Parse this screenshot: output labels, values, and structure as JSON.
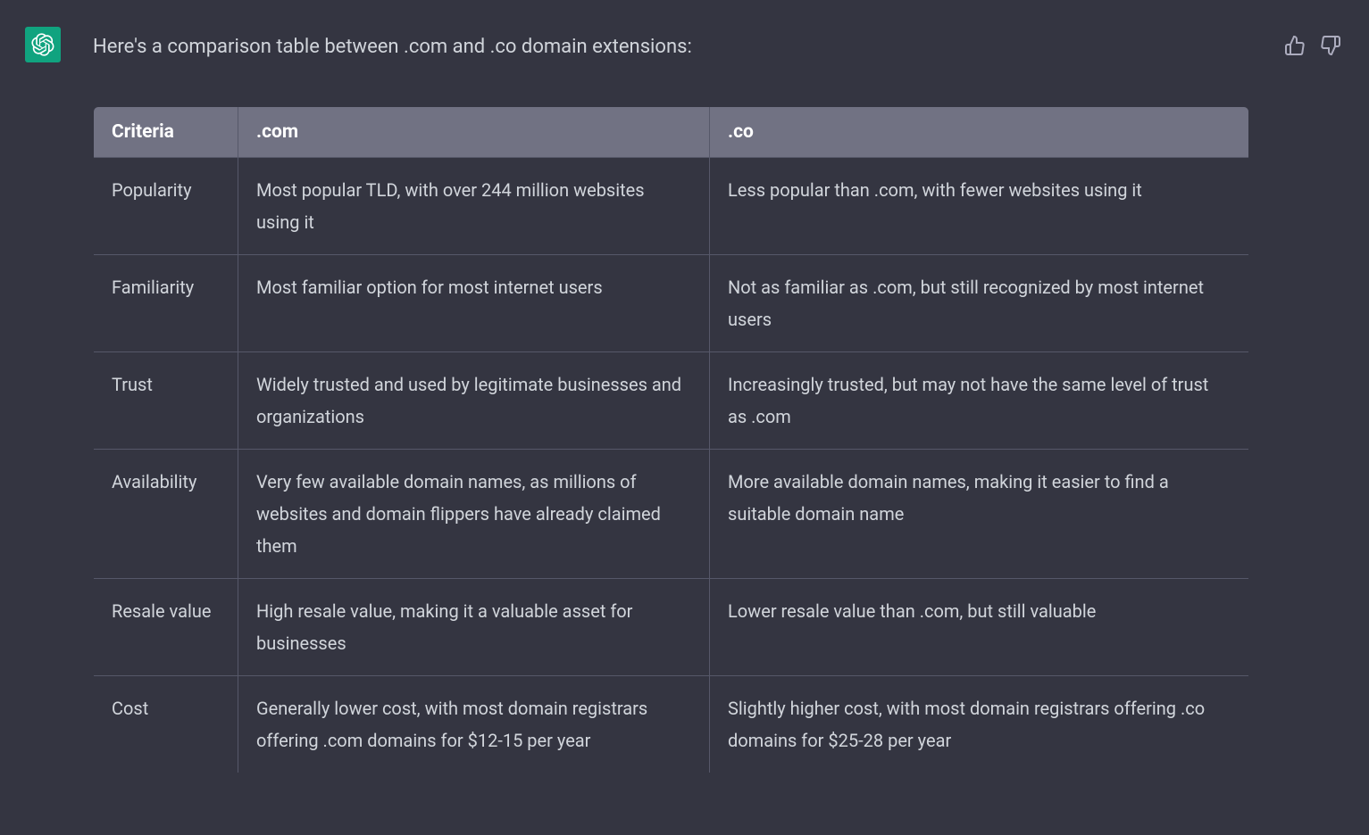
{
  "message": {
    "intro": "Here's a comparison table between .com and .co domain extensions:"
  },
  "table": {
    "headers": {
      "criteria": "Criteria",
      "com": ".com",
      "co": ".co"
    },
    "rows": [
      {
        "criteria": "Popularity",
        "com": "Most popular TLD, with over 244 million websites using it",
        "co": "Less popular than .com, with fewer websites using it"
      },
      {
        "criteria": "Familiarity",
        "com": "Most familiar option for most internet users",
        "co": "Not as familiar as .com, but still recognized by most internet users"
      },
      {
        "criteria": "Trust",
        "com": "Widely trusted and used by legitimate businesses and organizations",
        "co": "Increasingly trusted, but may not have the same level of trust as .com"
      },
      {
        "criteria": "Availability",
        "com": "Very few available domain names, as millions of websites and domain flippers have already claimed them",
        "co": "More available domain names, making it easier to find a suitable domain name"
      },
      {
        "criteria": "Resale value",
        "com": "High resale value, making it a valuable asset for businesses",
        "co": "Lower resale value than .com, but still valuable"
      },
      {
        "criteria": "Cost",
        "com": "Generally lower cost, with most domain registrars offering .com domains for $12-15 per year",
        "co": "Slightly higher cost, with most domain registrars offering .co domains for $25-28 per year"
      }
    ]
  }
}
